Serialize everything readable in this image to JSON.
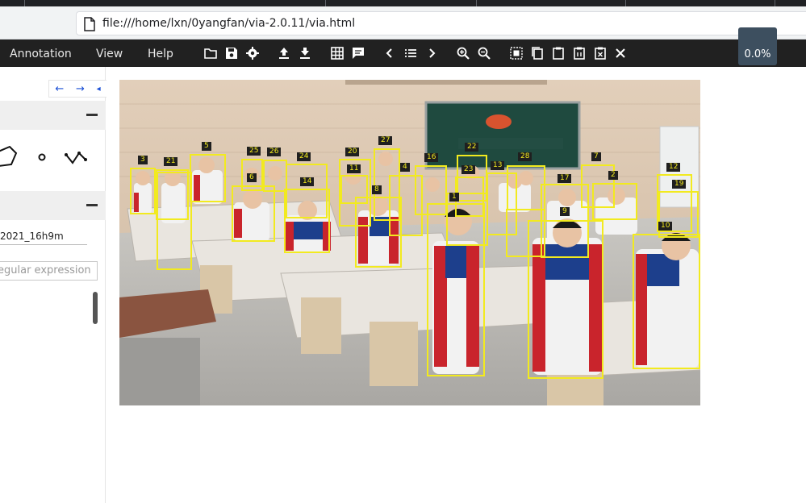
{
  "browser": {
    "url": "file:///home/lxn/0yangfan/via-2.0.11/via.html"
  },
  "menu": {
    "annotation": "Annotation",
    "view": "View",
    "help": "Help"
  },
  "toolbar": {
    "icons": [
      "open-folder-icon",
      "save-icon",
      "settings-icon",
      "upload-icon",
      "download-icon",
      "grid-icon",
      "comment-icon",
      "prev-icon",
      "list-icon",
      "next-icon",
      "zoom-in-icon",
      "zoom-out-icon",
      "select-all-icon",
      "copy-icon",
      "paste-icon",
      "paste-special-icon",
      "delete-region-icon",
      "close-icon"
    ],
    "progress": "0.0%"
  },
  "leftpanel": {
    "nav_prev": "←",
    "nav_next": "→",
    "nav_collapse": "◂",
    "filename": "2021_16h9m",
    "regex_placeholder": "egular expression"
  },
  "annotations": {
    "color": "#f2ea1f",
    "labels": [
      "3",
      "21",
      "5",
      "25",
      "26",
      "6",
      "24",
      "14",
      "20",
      "11",
      "27",
      "8",
      "4",
      "16",
      "22",
      "23",
      "1",
      "13",
      "28",
      "17",
      "9",
      "7",
      "2",
      "12",
      "19",
      "10"
    ]
  }
}
